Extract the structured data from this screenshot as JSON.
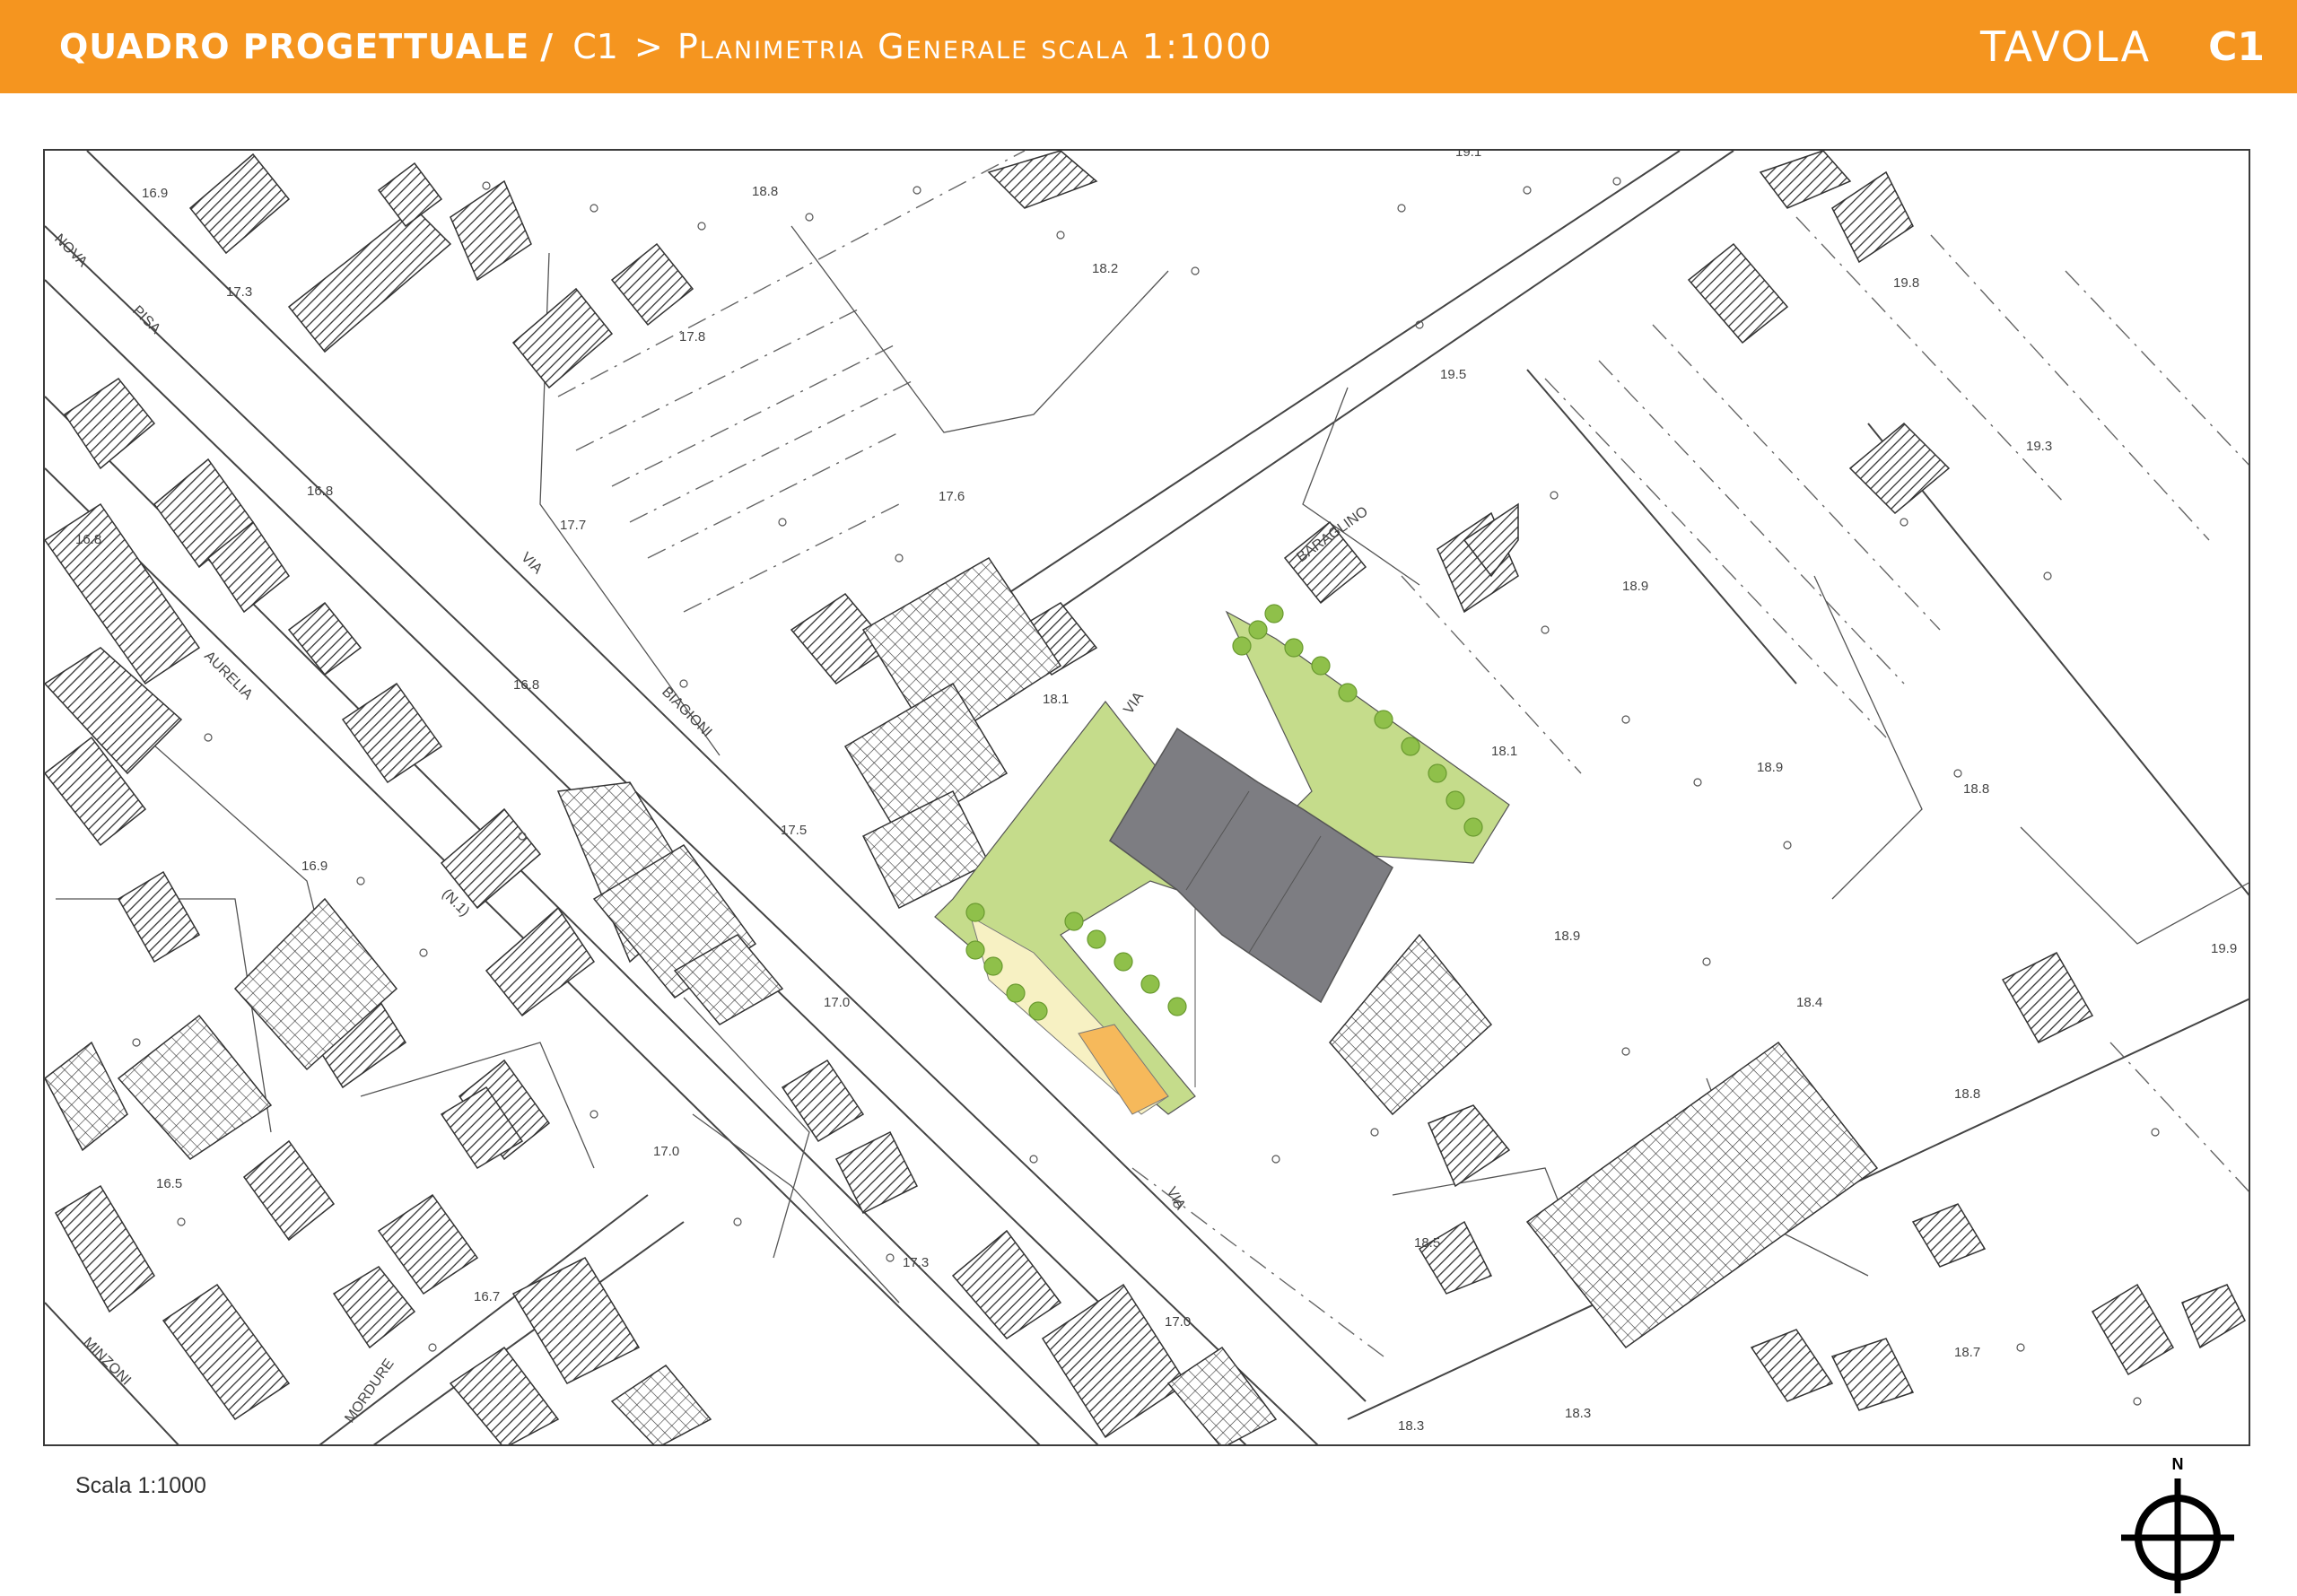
{
  "header": {
    "section": "QUADRO PROGETTUALE",
    "separator": "/",
    "code": "C1",
    "title": "> Planimetria Generale scala 1:1000",
    "tavola_label": "TAVOLA",
    "tavola_number": "C1"
  },
  "footer": {
    "scale_note": "Scala 1:1000",
    "north_label": "N"
  },
  "map": {
    "streets": {
      "via_pisa": [
        "NOVA",
        "PISA"
      ],
      "via_aurelia": [
        "AURELIA",
        "(N.1)"
      ],
      "via_biagioni": [
        "VIA",
        "BIAGIONI"
      ],
      "via_baraglino": [
        "VIA",
        "BARAGLINO"
      ],
      "via_lower": "VIA",
      "minzoni": "MINZONI",
      "mordure": "MORDURE"
    },
    "elevations": [
      "16.9",
      "17.3",
      "18.8",
      "18.2",
      "19.1",
      "19.8",
      "19.3",
      "19.5",
      "17.8",
      "17.7",
      "17.6",
      "16.8",
      "16.8",
      "16.8",
      "18.9",
      "18.1",
      "18.9",
      "17.5",
      "18.1",
      "18.8",
      "16.9",
      "18.9",
      "17.0",
      "18.4",
      "19.9",
      "16.5",
      "17.0",
      "18.8",
      "17.3",
      "18.5",
      "16.7",
      "17.0",
      "18.7",
      "18.3",
      "18.3"
    ],
    "colors": {
      "building_hatch": "#333333",
      "project_building": "#7d7d82",
      "green_area": "#c5dc8b",
      "tree": "#8fc04a",
      "parking_light": "#f7f1c3",
      "parking_orange": "#f6b95b"
    }
  }
}
